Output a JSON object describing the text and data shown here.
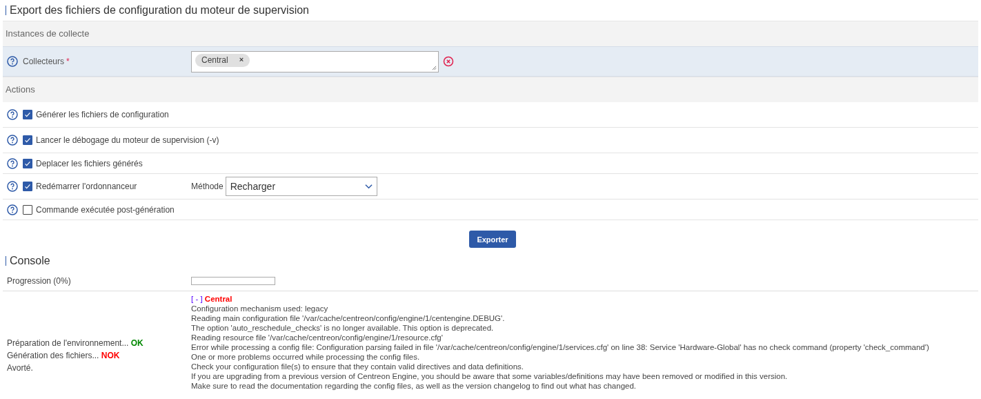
{
  "title": "Export des fichiers de configuration du moteur de supervision",
  "instances": {
    "header": "Instances de collecte",
    "label": "Collecteurs",
    "required": "*",
    "tags": [
      {
        "label": "Central",
        "remove": "×"
      }
    ]
  },
  "actions": {
    "header": "Actions",
    "items": [
      {
        "label": "Générer les fichiers de configuration",
        "checked": true
      },
      {
        "label": "Lancer le débogage du moteur de supervision (-v)",
        "checked": true
      },
      {
        "label": "Deplacer les fichiers générés",
        "checked": true
      },
      {
        "label": "Redémarrer l'ordonnanceur",
        "checked": true,
        "method_label": "Méthode",
        "method_value": "Recharger"
      },
      {
        "label": "Commande exécutée post-génération",
        "checked": false
      }
    ]
  },
  "export_button": "Exporter",
  "console": {
    "title": "Console",
    "progress_label": "Progression (0%)",
    "level": 0,
    "status": [
      {
        "text": "Préparation de l'environnement...",
        "result": "OK",
        "kind": "ok"
      },
      {
        "text": "Génération des fichiers...",
        "result": "NOK",
        "kind": "nok"
      },
      {
        "text": "Avorté.",
        "kind": "plain"
      }
    ],
    "log_marker": "[ - ]",
    "log_poller": "Central",
    "log_lines": [
      "Configuration mechanism used: legacy",
      "Reading main configuration file '/var/cache/centreon/config/engine/1/centengine.DEBUG'.",
      "The option 'auto_reschedule_checks' is no longer available. This option is deprecated.",
      "Reading resource file '/var/cache/centreon/config/engine/1/resource.cfg'",
      "Error while processing a config file: Configuration parsing failed in file '/var/cache/centreon/config/engine/1/services.cfg' on line 38: Service 'Hardware-Global' has no check command (property 'check_command')",
      "One or more problems occurred while processing the config files.",
      "Check your configuration file(s) to ensure that they contain valid directives and data definitions.",
      "If you are upgrading from a previous version of Centreon Engine, you should be aware that some variables/definitions may have been removed or modified in this version.",
      "Make sure to read the documentation regarding the config files, as well as the version changelog to find out what has changed."
    ]
  }
}
